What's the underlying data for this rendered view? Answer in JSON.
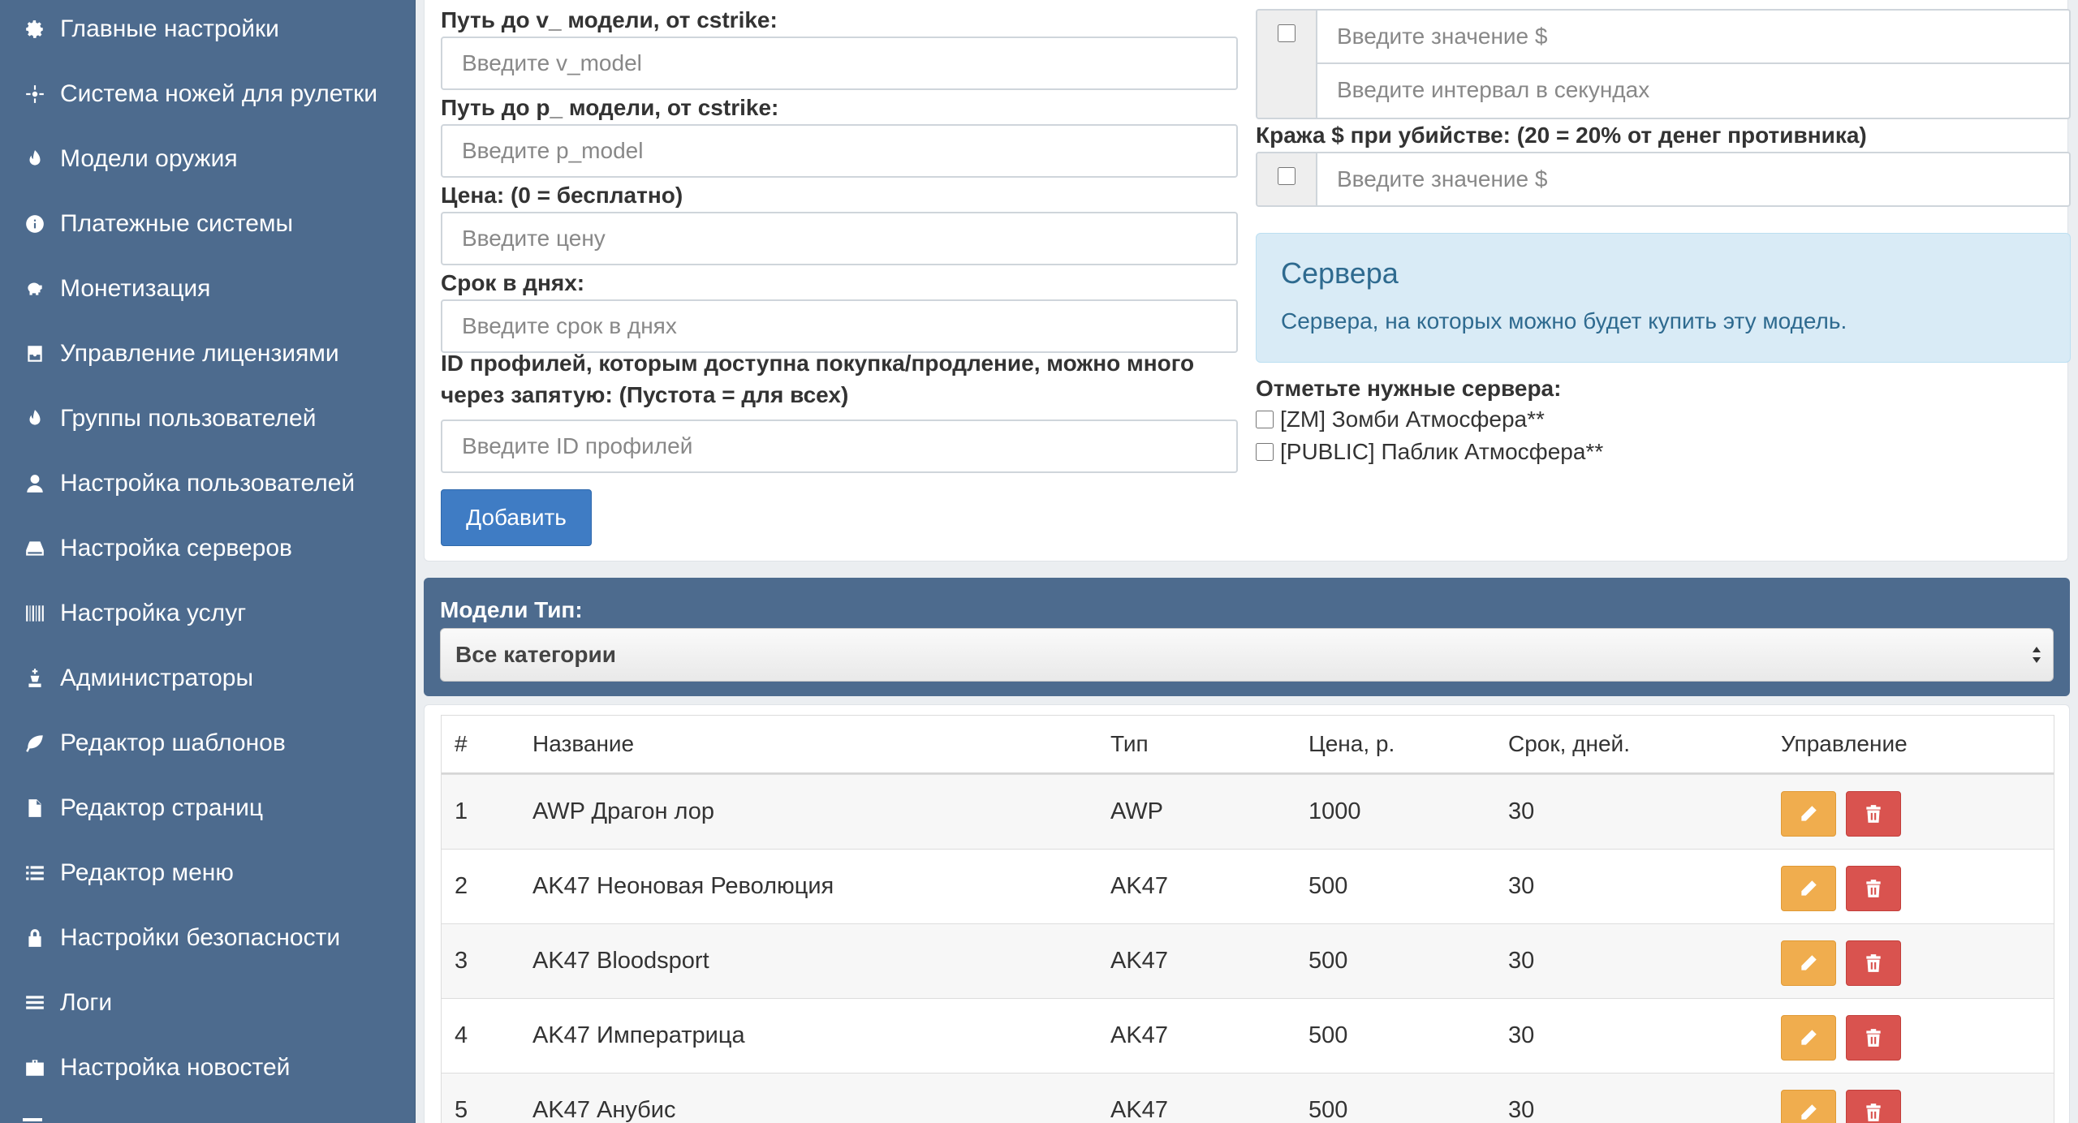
{
  "sidebar": {
    "items": [
      {
        "label": "Главные настройки",
        "icon": "gear-icon"
      },
      {
        "label": "Система ножей для рулетки",
        "icon": "crosshair-icon"
      },
      {
        "label": "Модели оружия",
        "icon": "fire-icon"
      },
      {
        "label": "Платежные системы",
        "icon": "info-icon"
      },
      {
        "label": "Монетизация",
        "icon": "piggy-bank-icon"
      },
      {
        "label": "Управление лицензиями",
        "icon": "inbox-icon"
      },
      {
        "label": "Группы пользователей",
        "icon": "fire-icon"
      },
      {
        "label": "Настройка пользователей",
        "icon": "user-icon"
      },
      {
        "label": "Настройка серверов",
        "icon": "hdd-icon"
      },
      {
        "label": "Настройка услуг",
        "icon": "barcode-icon"
      },
      {
        "label": "Администраторы",
        "icon": "king-icon"
      },
      {
        "label": "Редактор шаблонов",
        "icon": "leaf-icon"
      },
      {
        "label": "Редактор страниц",
        "icon": "file-icon"
      },
      {
        "label": "Редактор меню",
        "icon": "list-icon"
      },
      {
        "label": "Настройки безопасности",
        "icon": "lock-icon"
      },
      {
        "label": "Логи",
        "icon": "align-justify-icon"
      },
      {
        "label": "Настройка новостей",
        "icon": "briefcase-icon"
      }
    ]
  },
  "form": {
    "v_model": {
      "label": "Путь до v_ модели, от cstrike:",
      "placeholder": "Введите v_model",
      "value": ""
    },
    "p_model": {
      "label": "Путь до p_ модели, от cstrike:",
      "placeholder": "Введите p_model",
      "value": ""
    },
    "price": {
      "label": "Цена: (0 = бесплатно)",
      "placeholder": "Введите цену",
      "value": ""
    },
    "term": {
      "label": "Срок в днях:",
      "placeholder": "Введите срок в днях",
      "value": ""
    },
    "profiles": {
      "label": "ID профилей, которым доступна покупка/продление, можно много через запятую: (Пустота = для всех)",
      "placeholder": "Введите ID профилей",
      "value": ""
    },
    "submit_label": "Добавить",
    "money_bonus": {
      "placeholder_value": "Введите значение $",
      "placeholder_interval": "Введите интервал в секундах",
      "checked": false
    },
    "steal": {
      "label": "Кража $ при убийстве: (20 = 20% от денег противника)",
      "placeholder": "Введите значение $",
      "checked": false
    },
    "servers_info": {
      "title": "Сервера",
      "text": "Сервера, на которых можно будет купить эту модель."
    },
    "servers_label": "Отметьте нужные сервера:",
    "servers": [
      {
        "name": "[ZM] Зомби Атмосфера**",
        "checked": false
      },
      {
        "name": "[PUBLIC] Паблик Атмосфера**",
        "checked": false
      }
    ]
  },
  "filter": {
    "label": "Модели Тип:",
    "selected": "Все категории"
  },
  "table": {
    "headers": [
      "#",
      "Название",
      "Тип",
      "Цена, р.",
      "Срок, дней.",
      "Управление"
    ],
    "rows": [
      {
        "id": "1",
        "name": "AWP Драгон лор",
        "type": "AWP",
        "price": "1000",
        "term": "30"
      },
      {
        "id": "2",
        "name": "AK47 Неоновая Революция",
        "type": "AK47",
        "price": "500",
        "term": "30"
      },
      {
        "id": "3",
        "name": "AK47 Bloodsport",
        "type": "AK47",
        "price": "500",
        "term": "30"
      },
      {
        "id": "4",
        "name": "AK47 Императрица",
        "type": "AK47",
        "price": "500",
        "term": "30"
      },
      {
        "id": "5",
        "name": "AK47 Анубис",
        "type": "AK47",
        "price": "500",
        "term": "30"
      }
    ]
  },
  "colors": {
    "sidebar_bg": "#4d6b8e",
    "primary": "#3f7cc4",
    "edit": "#f0ad4e",
    "delete": "#d9534f",
    "info_bg": "#d9ebf6",
    "info_text": "#2e6a8f"
  }
}
